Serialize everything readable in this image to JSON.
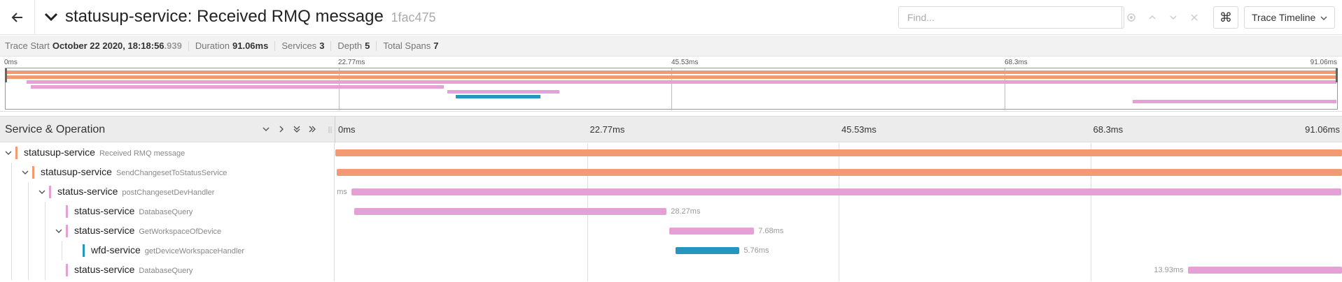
{
  "header": {
    "title": "statusup-service: Received RMQ message",
    "trace_id": "1fac475",
    "find_placeholder": "Find...",
    "view_mode": "Trace Timeline",
    "cmd_symbol": "⌘"
  },
  "info": {
    "trace_start_label": "Trace Start",
    "trace_start_value": "October 22 2020, 18:18:56",
    "trace_start_ms": ".939",
    "duration_label": "Duration",
    "duration_value": "91.06ms",
    "services_label": "Services",
    "services_value": "3",
    "depth_label": "Depth",
    "depth_value": "5",
    "total_spans_label": "Total Spans",
    "total_spans_value": "7"
  },
  "timeline_ticks": [
    "0ms",
    "22.77ms",
    "45.53ms",
    "68.3ms",
    "91.06ms"
  ],
  "colors": {
    "statusup": "#f29a72",
    "status": "#e5a1d6",
    "wfd": "#2596be"
  },
  "main": {
    "column_title": "Service & Operation"
  },
  "spans": [
    {
      "service": "statusup-service",
      "operation": "Received RMQ message",
      "depth": 0,
      "has_children": true,
      "color_key": "statusup",
      "start_ms": 0.0,
      "duration_ms": 91.06,
      "duration_label": ""
    },
    {
      "service": "statusup-service",
      "operation": "SendChangesetToStatusService",
      "depth": 1,
      "has_children": true,
      "color_key": "statusup",
      "start_ms": 0.1,
      "duration_ms": 90.95,
      "duration_label": ""
    },
    {
      "service": "status-service",
      "operation": "postChangesetDevHandler",
      "depth": 2,
      "has_children": true,
      "color_key": "status",
      "start_ms": 1.45,
      "duration_ms": 89.55,
      "duration_label": "ms"
    },
    {
      "service": "status-service",
      "operation": "DatabaseQuery",
      "depth": 3,
      "has_children": false,
      "color_key": "status",
      "start_ms": 1.7,
      "duration_ms": 28.27,
      "duration_label": "28.27ms"
    },
    {
      "service": "status-service",
      "operation": "GetWorkspaceOfDevice",
      "depth": 3,
      "has_children": true,
      "color_key": "status",
      "start_ms": 30.2,
      "duration_ms": 7.68,
      "duration_label": "7.68ms"
    },
    {
      "service": "wfd-service",
      "operation": "getDeviceWorkspaceHandler",
      "depth": 4,
      "has_children": false,
      "color_key": "wfd",
      "start_ms": 30.8,
      "duration_ms": 5.76,
      "duration_label": "5.76ms"
    },
    {
      "service": "status-service",
      "operation": "DatabaseQuery",
      "depth": 3,
      "has_children": false,
      "color_key": "status",
      "start_ms": 77.1,
      "duration_ms": 13.93,
      "duration_label": "13.93ms"
    }
  ]
}
